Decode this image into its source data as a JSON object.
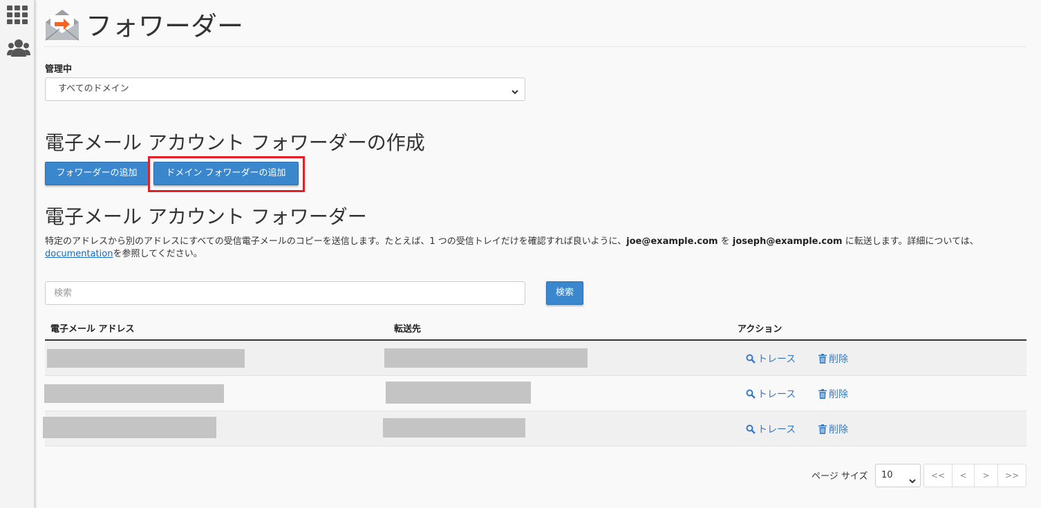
{
  "sidebar": {
    "items": [
      {
        "icon": "grid-icon"
      },
      {
        "icon": "users-icon"
      }
    ]
  },
  "header": {
    "title": "フォワーダー",
    "logo_icon": "envelope-forward-icon"
  },
  "managing": {
    "label": "管理中",
    "selected": "すべてのドメイン"
  },
  "create": {
    "heading": "電子メール アカウント フォワーダーの作成",
    "add_forwarder": "フォワーダーの追加",
    "add_domain_forwarder": "ドメイン フォワーダーの追加"
  },
  "list": {
    "heading": "電子メール アカウント フォワーダー",
    "desc_part1": "特定のアドレスから別のアドレスにすべての受信電子メールのコピーを送信します。たとえば、1 つの受信トレイだけを確認すれば良いように、",
    "desc_example1": "joe@example.com",
    "desc_part2": " を ",
    "desc_example2": "joseph@example.com",
    "desc_part3": " に転送します。詳細については、",
    "desc_link": "documentation",
    "desc_part4": "を参照してください。"
  },
  "search": {
    "placeholder": "検索",
    "button": "検索"
  },
  "table": {
    "headers": [
      "電子メール アドレス",
      "転送先",
      "アクション"
    ],
    "trace_label": "トレース",
    "delete_label": "削除"
  },
  "pager": {
    "page_size_label": "ページ サイズ",
    "page_size": "10",
    "first": "<<",
    "prev": "<",
    "next": ">",
    "last": ">>"
  },
  "colors": {
    "primary": "#3a87ce",
    "highlight": "#e01f26",
    "link": "#3579c0",
    "accent_orange": "#f26522"
  }
}
